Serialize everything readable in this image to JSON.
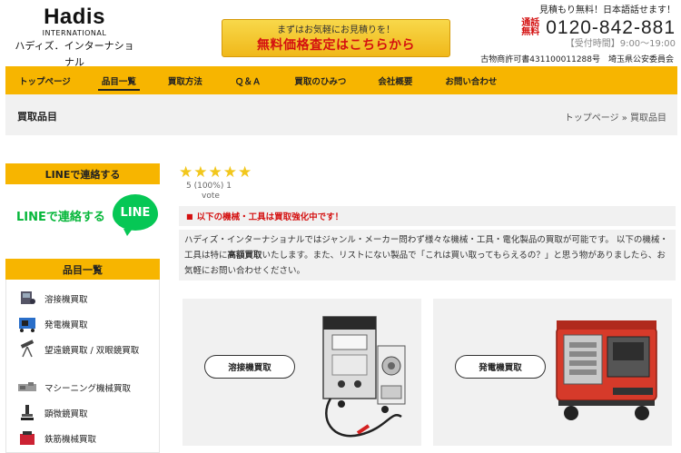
{
  "header": {
    "logo_main": "Hadis",
    "logo_sub": "INTERNATIONAL",
    "logo_jp": "ハディズ．インターナショナル",
    "cta_top": "まずはお気軽にお見積りを！",
    "cta_main": "無料価格査定はこちらから",
    "contact_top": "見積もり無料！日本語話せます！",
    "free_label_1": "通話",
    "free_label_2": "無料",
    "phone": "0120-842-881",
    "hours": "【受付時間】9:00～19:00",
    "license": "古物商許可書431100011288号　埼玉県公安委員会"
  },
  "nav": {
    "items": [
      {
        "label": "トップページ"
      },
      {
        "label": "品目一覧"
      },
      {
        "label": "買取方法"
      },
      {
        "label": "Ｑ＆Ａ"
      },
      {
        "label": "買取のひみつ"
      },
      {
        "label": "会社概要"
      },
      {
        "label": "お問い合わせ"
      }
    ]
  },
  "page": {
    "title": "買取品目",
    "breadcrumb": "トップページ » 買取品目"
  },
  "sidebar": {
    "line_heading": "LINEで連絡する",
    "line_text": "LINEで連絡する",
    "line_badge": "LINE",
    "categories_heading": "品目一覧",
    "categories": [
      {
        "label": "溶接機買取",
        "icon": "welder-icon"
      },
      {
        "label": "発電機買取",
        "icon": "generator-icon"
      },
      {
        "label": "望遠鏡買取 / 双眼鏡買取",
        "icon": "telescope-icon"
      },
      {
        "label": "マシーニング機械買取",
        "icon": "machining-icon"
      },
      {
        "label": "顕微鏡買取",
        "icon": "microscope-icon"
      },
      {
        "label": "鉄筋機械買取",
        "icon": "rebar-machine-icon"
      }
    ]
  },
  "main": {
    "rating": {
      "stars": 5,
      "summary": "5 (100%) 1",
      "vote": "vote"
    },
    "notice": "以下の機械・工具は買取強化中です！",
    "intro_part1": "ハディズ・インターナショナルではジャンル・メーカー問わず様々な機械・工具・電化製品の買取が可能です。 以下の機械・工具は特に",
    "intro_bold": "高額買取",
    "intro_part2": "いたします。また、リストにない製品で「これは買い取ってもらえるの？」と思う物がありましたら、お気軽にお問い合わせください。",
    "products": [
      {
        "label": "溶接機買取",
        "image": "welding-machine"
      },
      {
        "label": "発電機買取",
        "image": "generator"
      }
    ]
  },
  "colors": {
    "accent": "#f7b500",
    "alert_red": "#d41010",
    "line_green": "#06c755",
    "panel_gray": "#f1f1f1"
  }
}
